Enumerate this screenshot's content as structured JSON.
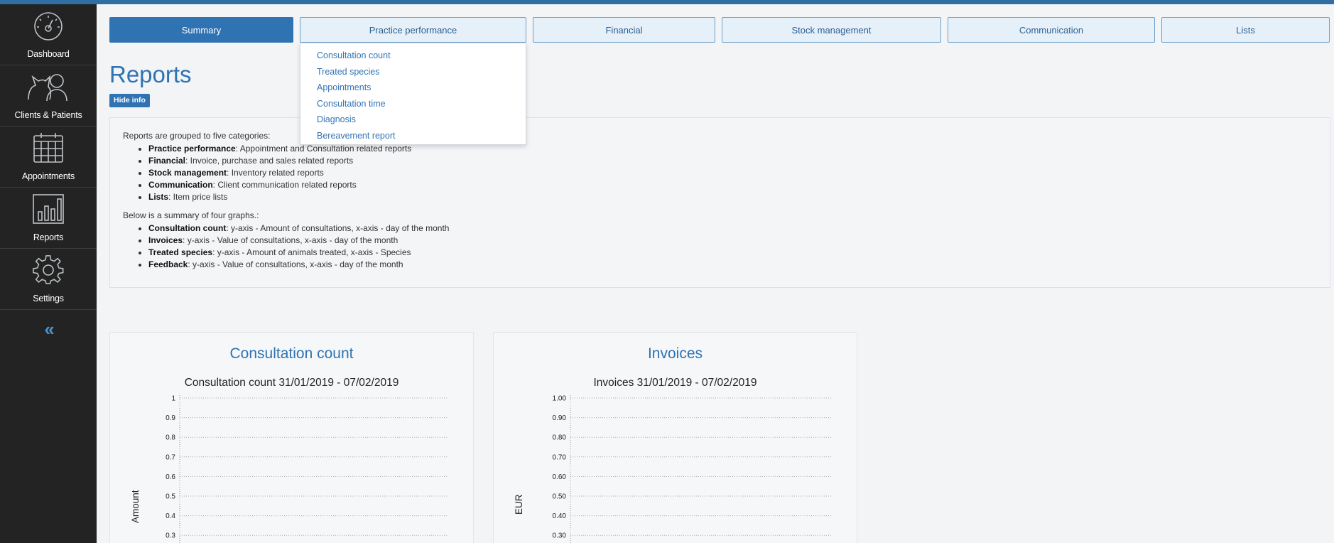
{
  "sidebar": {
    "items": [
      {
        "label": "Dashboard",
        "icon": "speedometer-icon"
      },
      {
        "label": "Clients & Patients",
        "icon": "cat-person-icon"
      },
      {
        "label": "Appointments",
        "icon": "calendar-icon"
      },
      {
        "label": "Reports",
        "icon": "bar-chart-icon"
      },
      {
        "label": "Settings",
        "icon": "gear-icon"
      }
    ],
    "collapse_label": "‹‹"
  },
  "tabs": [
    {
      "label": "Summary",
      "active": true
    },
    {
      "label": "Practice performance",
      "active": false
    },
    {
      "label": "Financial",
      "active": false
    },
    {
      "label": "Stock management",
      "active": false
    },
    {
      "label": "Communication",
      "active": false
    },
    {
      "label": "Lists",
      "active": false
    }
  ],
  "dropdown": {
    "items": [
      "Consultation count",
      "Treated species",
      "Appointments",
      "Consultation time",
      "Diagnosis",
      "Bereavement report"
    ]
  },
  "page": {
    "title": "Reports",
    "hide_info_label": "Hide info"
  },
  "info": {
    "intro": "Reports are grouped to five categories:",
    "categories": [
      {
        "name": "Practice performance",
        "desc": ": Appointment and Consultation related reports"
      },
      {
        "name": "Financial",
        "desc": ": Invoice, purchase and sales related reports"
      },
      {
        "name": "Stock management",
        "desc": ": Inventory related reports"
      },
      {
        "name": "Communication",
        "desc": ": Client communication related reports"
      },
      {
        "name": "Lists",
        "desc": ": Item price lists"
      }
    ],
    "graphs_intro": "Below is a summary of four graphs.:",
    "graphs": [
      {
        "name": "Consultation count",
        "desc": ": y-axis - Amount of consultations, x-axis - day of the month"
      },
      {
        "name": "Invoices",
        "desc": ": y-axis - Value of consultations, x-axis - day of the month"
      },
      {
        "name": "Treated species",
        "desc": ": y-axis - Amount of animals treated, x-axis - Species"
      },
      {
        "name": "Feedback",
        "desc": ": y-axis - Value of consultations, x-axis - day of the month"
      }
    ]
  },
  "cards": [
    {
      "title": "Consultation count"
    },
    {
      "title": "Invoices"
    }
  ],
  "chart_data": [
    {
      "type": "line",
      "title": "Consultation count 31/01/2019 - 07/02/2019",
      "xlabel": "",
      "ylabel": "Amount",
      "ylim": [
        0,
        1
      ],
      "yticks": [
        "1",
        "0.9",
        "0.8",
        "0.7",
        "0.6",
        "0.5",
        "0.4",
        "0.3"
      ],
      "series": [],
      "grid": true
    },
    {
      "type": "line",
      "title": "Invoices 31/01/2019 - 07/02/2019",
      "xlabel": "",
      "ylabel": "EUR",
      "ylim": [
        0,
        1
      ],
      "yticks": [
        "1.00",
        "0.90",
        "0.80",
        "0.70",
        "0.60",
        "0.50",
        "0.40",
        "0.30"
      ],
      "series": [],
      "grid": true
    }
  ],
  "colors": {
    "accent": "#2f73b2",
    "sidebar_bg": "#222322",
    "link": "#3374b6"
  }
}
